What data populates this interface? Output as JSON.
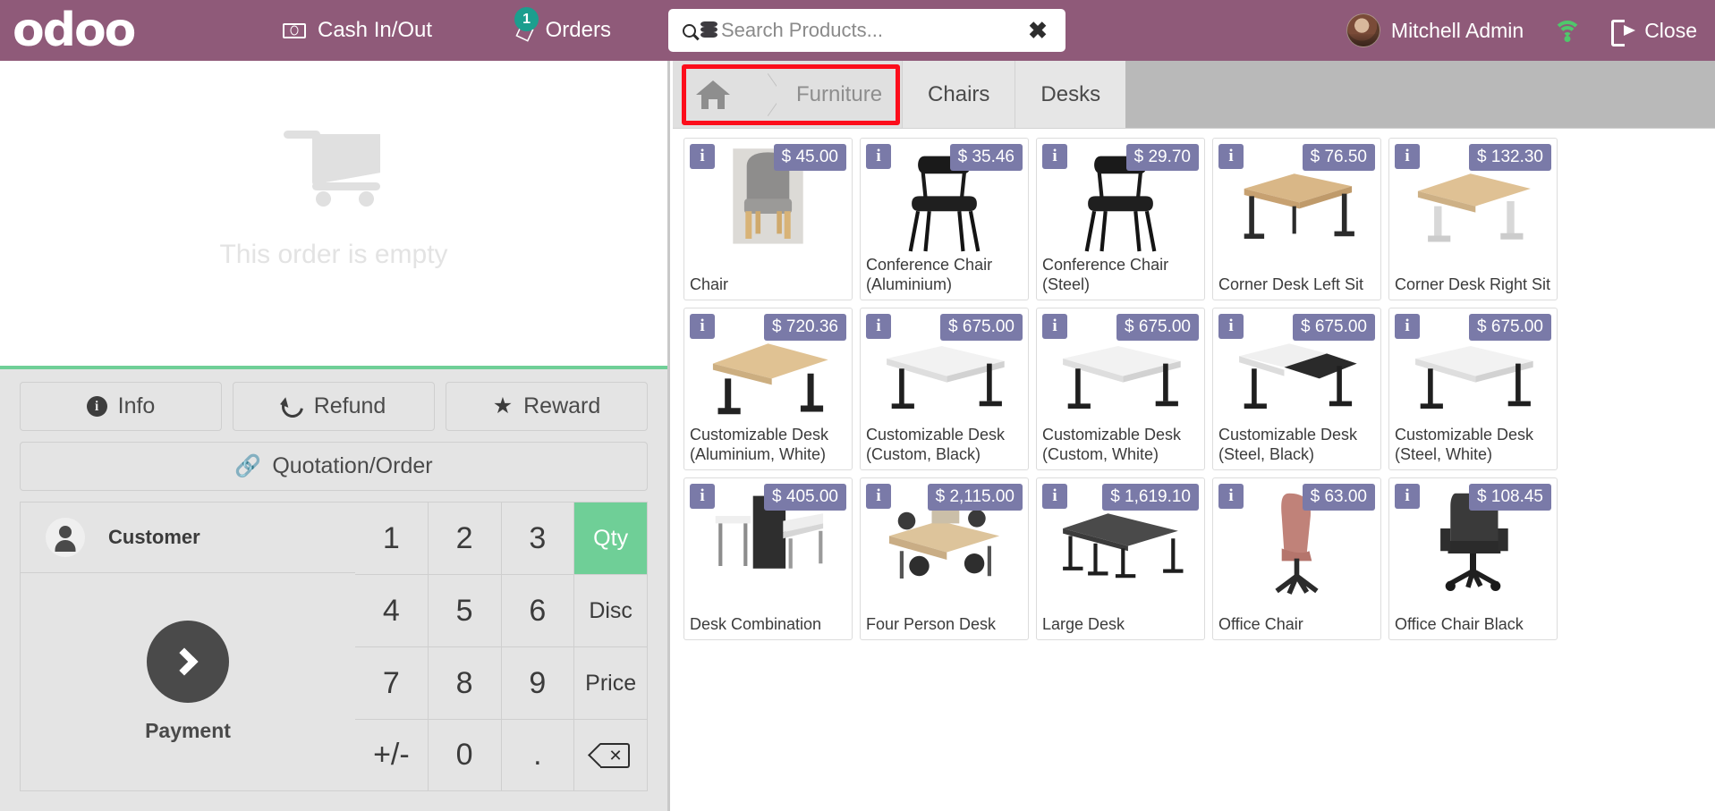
{
  "topbar": {
    "logo": "odoo",
    "cash_in_out": "Cash In/Out",
    "orders": "Orders",
    "orders_count": "1",
    "search_placeholder": "Search Products...",
    "search_value": "",
    "clear_label": "✖",
    "user_name": "Mitchell Admin",
    "close_label": "Close"
  },
  "order": {
    "empty_text": "This order is empty"
  },
  "actions": {
    "info": "Info",
    "refund": "Refund",
    "reward": "Reward",
    "quotation_order": "Quotation/Order"
  },
  "customer": {
    "label": "Customer",
    "payment_label": "Payment"
  },
  "numpad": {
    "keys": [
      {
        "label": "1",
        "type": "digit"
      },
      {
        "label": "2",
        "type": "digit"
      },
      {
        "label": "3",
        "type": "digit"
      },
      {
        "label": "Qty",
        "type": "mode",
        "active": true
      },
      {
        "label": "4",
        "type": "digit"
      },
      {
        "label": "5",
        "type": "digit"
      },
      {
        "label": "6",
        "type": "digit"
      },
      {
        "label": "Disc",
        "type": "mode",
        "active": false
      },
      {
        "label": "7",
        "type": "digit"
      },
      {
        "label": "8",
        "type": "digit"
      },
      {
        "label": "9",
        "type": "digit"
      },
      {
        "label": "Price",
        "type": "mode",
        "active": false
      },
      {
        "label": "+/-",
        "type": "digit"
      },
      {
        "label": "0",
        "type": "digit"
      },
      {
        "label": ".",
        "type": "digit"
      },
      {
        "label": "backspace",
        "type": "icon"
      }
    ]
  },
  "categories": {
    "breadcrumb_home": "home-icon",
    "current": "Furniture",
    "tabs": [
      "Chairs",
      "Desks"
    ],
    "highlighted": "Furniture"
  },
  "products": [
    {
      "name": "Chair",
      "price": "$ 45.00",
      "img": "chair-grey"
    },
    {
      "name": "Conference Chair (Aluminium)",
      "price": "$ 35.46",
      "img": "conf-chair-black"
    },
    {
      "name": "Conference Chair (Steel)",
      "price": "$ 29.70",
      "img": "conf-chair-black"
    },
    {
      "name": "Corner Desk Left Sit",
      "price": "$ 76.50",
      "img": "desk-wood"
    },
    {
      "name": "Corner Desk Right Sit",
      "price": "$ 132.30",
      "img": "desk-wood-white"
    },
    {
      "name": "Customizable Desk (Aluminium, White)",
      "price": "$ 720.36",
      "img": "desk-wood-black"
    },
    {
      "name": "Customizable Desk (Custom, Black)",
      "price": "$ 675.00",
      "img": "desk-white"
    },
    {
      "name": "Customizable Desk (Custom, White)",
      "price": "$ 675.00",
      "img": "desk-white"
    },
    {
      "name": "Customizable Desk (Steel, Black)",
      "price": "$ 675.00",
      "img": "desk-white-dark"
    },
    {
      "name": "Customizable Desk (Steel, White)",
      "price": "$ 675.00",
      "img": "desk-white"
    },
    {
      "name": "Desk Combination",
      "price": "$ 405.00",
      "img": "desk-combination"
    },
    {
      "name": "Four Person Desk",
      "price": "$ 2,115.00",
      "img": "four-person-desk"
    },
    {
      "name": "Large Desk",
      "price": "$ 1,619.10",
      "img": "large-desk"
    },
    {
      "name": "Office Chair",
      "price": "$ 63.00",
      "img": "office-chair-pink"
    },
    {
      "name": "Office Chair Black",
      "price": "$ 108.45",
      "img": "office-chair-black"
    }
  ],
  "colors": {
    "brand_purple": "#8f5a79",
    "accent_green": "#6fcf97",
    "badge_purple": "#7a7aa8",
    "highlight_red": "#fc0d1b",
    "teal_badge": "#1b9e8e"
  }
}
